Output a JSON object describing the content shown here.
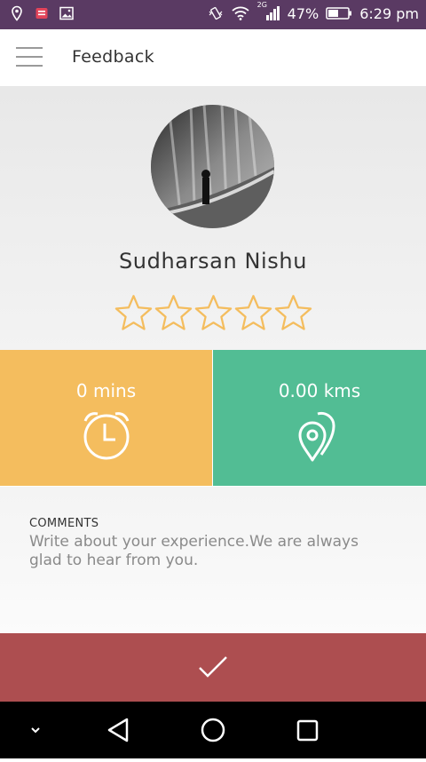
{
  "status_bar": {
    "battery_percent": "47%",
    "network": "2G",
    "time": "6:29 pm",
    "icons": [
      "location-icon",
      "notification-icon",
      "gallery-icon",
      "vibrate-icon",
      "wifi-icon",
      "signal-icon",
      "battery-icon"
    ]
  },
  "app_bar": {
    "title": "Feedback",
    "menu_icon": "hamburger-icon"
  },
  "profile": {
    "name": "Sudharsan Nishu",
    "rating": {
      "value": 0,
      "max": 5
    }
  },
  "stats": {
    "time": {
      "value": "0 mins",
      "icon": "alarm-clock-icon",
      "color": "#f4bd5e"
    },
    "distance": {
      "value": "0.00 kms",
      "icon": "map-pins-icon",
      "color": "#52bd94"
    }
  },
  "comments": {
    "label": "COMMENTS",
    "value": "",
    "placeholder": "Write about your experience.We are always glad to hear from you."
  },
  "submit": {
    "icon": "checkmark-icon",
    "color": "#ad4e50"
  },
  "nav": {
    "buttons": [
      "chevron-down-icon",
      "back-icon",
      "home-icon",
      "recents-icon"
    ]
  },
  "colors": {
    "status_bar": "#5a3a63",
    "star_outline": "#f4bd5e"
  }
}
